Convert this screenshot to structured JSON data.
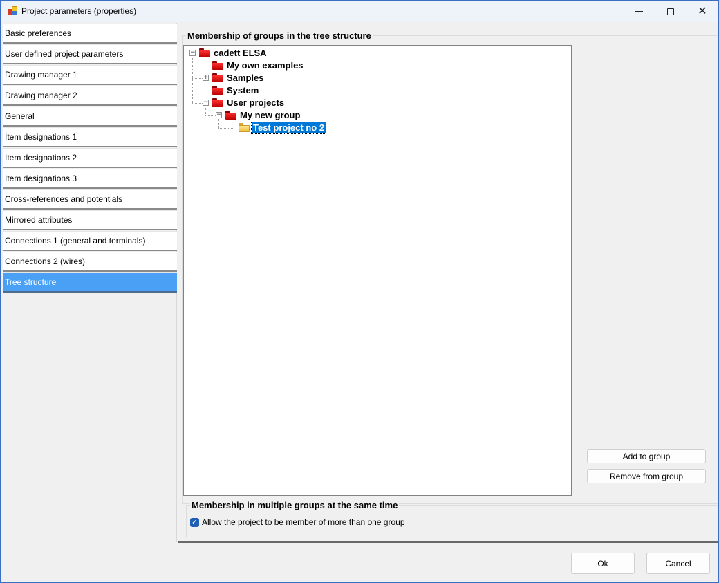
{
  "window": {
    "title": "Project parameters (properties)",
    "controls": {
      "minimize": "minimize",
      "maximize": "maximize",
      "close": "close"
    }
  },
  "sidebar": {
    "items": [
      {
        "label": "Basic preferences",
        "active": false
      },
      {
        "label": "User defined project parameters",
        "active": false
      },
      {
        "label": "Drawing manager 1",
        "active": false
      },
      {
        "label": "Drawing manager 2",
        "active": false
      },
      {
        "label": "General",
        "active": false
      },
      {
        "label": "Item designations 1",
        "active": false
      },
      {
        "label": "Item designations 2",
        "active": false
      },
      {
        "label": "Item designations 3",
        "active": false
      },
      {
        "label": "Cross-references and potentials",
        "active": false
      },
      {
        "label": "Mirrored attributes",
        "active": false
      },
      {
        "label": "Connections 1 (general and terminals)",
        "active": false
      },
      {
        "label": "Connections 2 (wires)",
        "active": false
      },
      {
        "label": "Tree structure",
        "active": true
      }
    ]
  },
  "tree_section": {
    "title": "Membership of groups in the tree structure",
    "nodes": [
      {
        "label": "cadett ELSA",
        "level": 0,
        "expander": "minus",
        "icon": "red-folder"
      },
      {
        "label": "My own examples",
        "level": 1,
        "expander": null,
        "icon": "red-folder"
      },
      {
        "label": "Samples",
        "level": 1,
        "expander": "plus",
        "icon": "red-folder"
      },
      {
        "label": "System",
        "level": 1,
        "expander": null,
        "icon": "red-folder"
      },
      {
        "label": "User projects",
        "level": 1,
        "expander": "minus",
        "icon": "red-folder"
      },
      {
        "label": "My new group",
        "level": 2,
        "expander": "minus",
        "icon": "red-folder"
      },
      {
        "label": "Test project no 2",
        "level": 3,
        "expander": null,
        "icon": "yellow-folder",
        "selected": true
      }
    ],
    "expander_glyphs": {
      "minus": "−",
      "plus": "+"
    },
    "buttons": {
      "add": "Add to group",
      "remove": "Remove from group"
    }
  },
  "multi_section": {
    "title": "Membership in multiple groups at the same time",
    "checkbox_label": "Allow the project to be member of more than one group",
    "checked": true,
    "check_glyph": "✓"
  },
  "footer": {
    "ok": "Ok",
    "cancel": "Cancel"
  },
  "colors": {
    "accent": "#0078d7",
    "nav_active": "#4aa0f4"
  }
}
